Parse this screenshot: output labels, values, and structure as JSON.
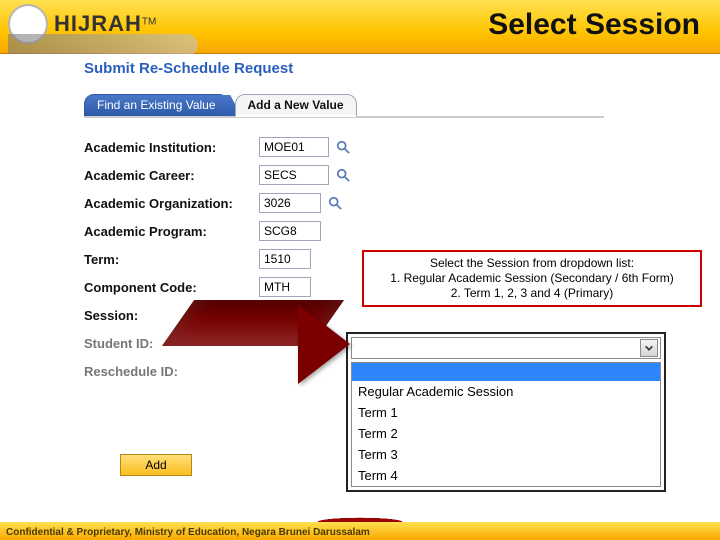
{
  "header": {
    "brand": "HIJRAH",
    "tm": "TM",
    "title": "Select Session"
  },
  "section_title": "Submit Re-Schedule Request",
  "tabs": {
    "find": "Find an Existing Value",
    "add": "Add a New Value"
  },
  "form": {
    "inst_label": "Academic Institution:",
    "inst_value": "MOE01",
    "career_label": "Academic Career:",
    "career_value": "SECS",
    "org_label": "Academic Organization:",
    "org_value": "3026",
    "program_label": "Academic Program:",
    "program_value": "SCG8",
    "term_label": "Term:",
    "term_value": "1510",
    "compcode_label": "Component Code:",
    "compcode_value": "MTH",
    "session_label": "Session:",
    "student_label": "Student ID:",
    "resched_label": "Reschedule ID:"
  },
  "add_button": "Add",
  "callout": {
    "line1": "Select the Session from dropdown list:",
    "line2": "1. Regular Academic Session (Secondary / 6th Form)",
    "line3": "2. Term 1, 2, 3 and 4 (Primary)"
  },
  "dropdown": {
    "options": [
      "",
      "Regular Academic Session",
      "Term 1",
      "Term 2",
      "Term 3",
      "Term 4"
    ]
  },
  "footer": "Confidential & Proprietary, Ministry of Education, Negara Brunei Darussalam",
  "icons": {
    "lookup": "search-icon",
    "chevron": "chevron-down-icon"
  },
  "chart_data": {
    "type": "table",
    "note": "no chart present"
  }
}
